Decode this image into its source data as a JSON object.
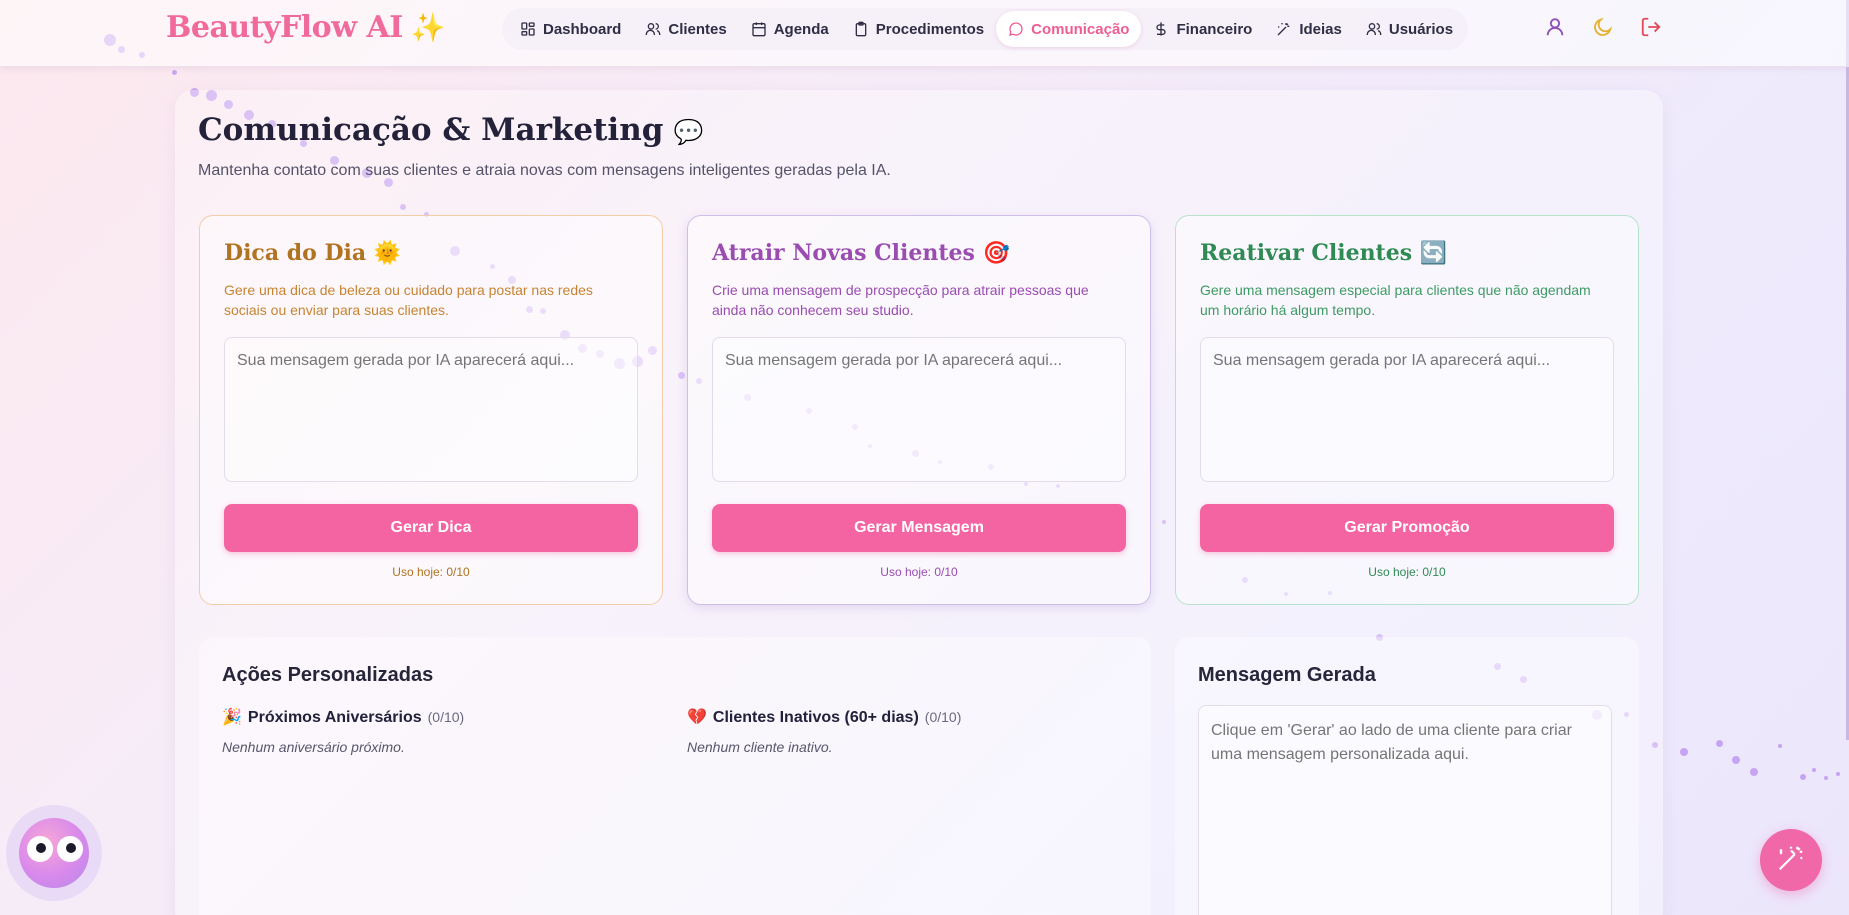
{
  "header": {
    "brand": "BeautyFlow AI",
    "brand_emoji": "✨",
    "nav": [
      {
        "label": "Dashboard",
        "icon": "dashboard-grid-icon",
        "active": false
      },
      {
        "label": "Clientes",
        "icon": "users-icon",
        "active": false
      },
      {
        "label": "Agenda",
        "icon": "calendar-icon",
        "active": false
      },
      {
        "label": "Procedimentos",
        "icon": "clipboard-icon",
        "active": false
      },
      {
        "label": "Comunicação",
        "icon": "message-circle-icon",
        "active": true
      },
      {
        "label": "Financeiro",
        "icon": "dollar-icon",
        "active": false
      },
      {
        "label": "Ideias",
        "icon": "wand-icon",
        "active": false
      },
      {
        "label": "Usuários",
        "icon": "users-icon",
        "active": false
      }
    ],
    "actions": [
      "user-icon",
      "moon-icon",
      "logout-icon"
    ]
  },
  "page": {
    "title": "Comunicação & Marketing",
    "title_emoji": "💬",
    "subtitle": "Mantenha contato com suas clientes e atraia novas com mensagens inteligentes geradas pela IA."
  },
  "cards": [
    {
      "title": "Dica do Dia",
      "emoji": "🌞",
      "description": "Gere uma dica de beleza ou cuidado para postar nas redes sociais ou enviar para suas clientes.",
      "placeholder": "Sua mensagem gerada por IA aparecerá aqui...",
      "button": "Gerar Dica",
      "usage": "Uso hoje: 0/10",
      "color": "#b0731f"
    },
    {
      "title": "Atrair Novas Clientes",
      "emoji": "🎯",
      "description": "Crie uma mensagem de prospecção para atrair pessoas que ainda não conhecem seu studio.",
      "placeholder": "Sua mensagem gerada por IA aparecerá aqui...",
      "button": "Gerar Mensagem",
      "usage": "Uso hoje: 0/10",
      "color": "#9a4cb0"
    },
    {
      "title": "Reativar Clientes",
      "emoji": "🔄",
      "description": "Gere uma mensagem especial para clientes que não agendam um horário há algum tempo.",
      "placeholder": "Sua mensagem gerada por IA aparecerá aqui...",
      "button": "Gerar Promoção",
      "usage": "Uso hoje: 0/10",
      "color": "#2f8a54"
    }
  ],
  "acoes": {
    "title": "Ações Personalizadas",
    "aniversarios": {
      "emoji": "🎉",
      "label": "Próximos Aniversários",
      "count": "(0/10)",
      "empty": "Nenhum aniversário próximo."
    },
    "inativos": {
      "emoji": "💔",
      "label": "Clientes Inativos (60+ dias)",
      "count": "(0/10)",
      "empty": "Nenhum cliente inativo."
    }
  },
  "mensagem": {
    "title": "Mensagem Gerada",
    "placeholder": "Clique em 'Gerar' ao lado de uma cliente para criar uma mensagem personalizada aqui."
  },
  "colors": {
    "accent": "#f564a2",
    "brand": "#f06a9b",
    "active_nav": "#ee5d93"
  }
}
